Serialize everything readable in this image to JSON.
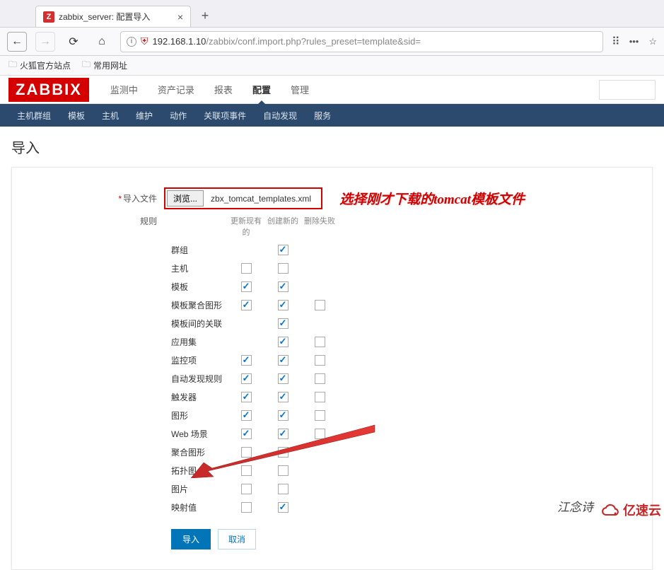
{
  "browser": {
    "tab_title": "zabbix_server: 配置导入",
    "favicon_letter": "Z",
    "url_host": "192.168.1.10",
    "url_path": "/zabbix/conf.import.php?rules_preset=template&sid=",
    "bookmarks": [
      "火狐官方站点",
      "常用网址"
    ]
  },
  "zabbix": {
    "logo": "ZABBIX",
    "main_nav": [
      "监测中",
      "资产记录",
      "报表",
      "配置",
      "管理"
    ],
    "main_nav_active": "配置",
    "sub_nav": [
      "主机群组",
      "模板",
      "主机",
      "维护",
      "动作",
      "关联项事件",
      "自动发现",
      "服务"
    ]
  },
  "page": {
    "title": "导入",
    "file_label": "导入文件",
    "browse_btn": "浏览...",
    "file_name": "zbx_tomcat_templates.xml",
    "annotation": "选择刚才下载的tomcat模板文件",
    "rules_label": "规则",
    "col_update": "更新现有的",
    "col_create": "创建新的",
    "col_delete": "删除失败",
    "rules": [
      {
        "label": "群组",
        "update": null,
        "create": true,
        "delete": null
      },
      {
        "label": "主机",
        "update": false,
        "create": false,
        "delete": null
      },
      {
        "label": "模板",
        "update": true,
        "create": true,
        "delete": null
      },
      {
        "label": "模板聚合图形",
        "update": true,
        "create": true,
        "delete": false
      },
      {
        "label": "模板间的关联",
        "update": null,
        "create": true,
        "delete": null
      },
      {
        "label": "应用集",
        "update": null,
        "create": true,
        "delete": false
      },
      {
        "label": "监控项",
        "update": true,
        "create": true,
        "delete": false
      },
      {
        "label": "自动发现规则",
        "update": true,
        "create": true,
        "delete": false
      },
      {
        "label": "触发器",
        "update": true,
        "create": true,
        "delete": false
      },
      {
        "label": "图形",
        "update": true,
        "create": true,
        "delete": false
      },
      {
        "label": "Web 场景",
        "update": true,
        "create": true,
        "delete": false
      },
      {
        "label": "聚合图形",
        "update": false,
        "create": false,
        "delete": null
      },
      {
        "label": "拓扑图",
        "update": false,
        "create": false,
        "delete": null
      },
      {
        "label": "图片",
        "update": false,
        "create": false,
        "delete": null
      },
      {
        "label": "映射值",
        "update": false,
        "create": true,
        "delete": null
      }
    ],
    "import_btn": "导入",
    "cancel_btn": "取消"
  },
  "watermark1": "江念诗",
  "watermark2": "亿速云"
}
